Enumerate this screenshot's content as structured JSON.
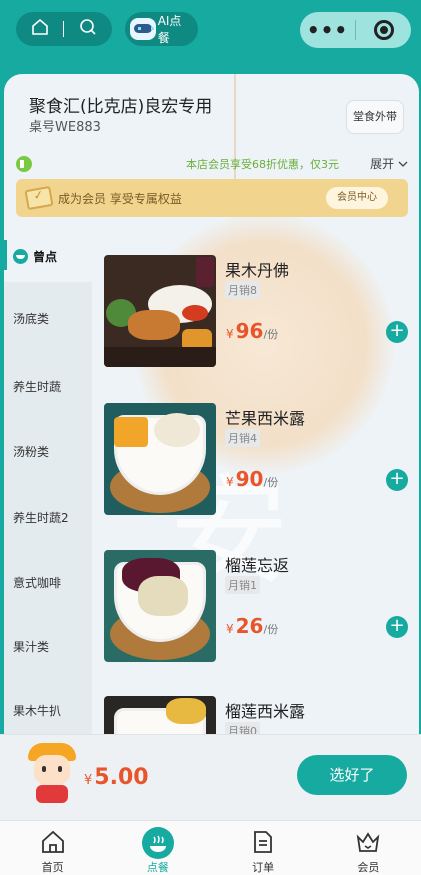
{
  "topbar": {
    "ai_label": "AI点餐",
    "capsule_more": "•••"
  },
  "store": {
    "name": "聚食汇(比克店)良宏专用",
    "table": "桌号WE883",
    "dine_toggle": "堂食外带"
  },
  "notice": {
    "text": "本店会员享受68折优惠，仅3元",
    "expand": "展开"
  },
  "member": {
    "text": "成为会员 享受专属权益",
    "button": "会员中心"
  },
  "categories": [
    {
      "label": "曾点"
    },
    {
      "label": "汤底类"
    },
    {
      "label": "养生时蔬"
    },
    {
      "label": "汤粉类"
    },
    {
      "label": "养生时蔬2"
    },
    {
      "label": "意式咖啡"
    },
    {
      "label": "果汁类"
    },
    {
      "label": "果木牛扒"
    }
  ],
  "dishes": [
    {
      "name": "果木丹佛",
      "sold": "月销8",
      "currency": "¥",
      "price": "96",
      "unit": "/份"
    },
    {
      "name": "芒果西米露",
      "sold": "月销4",
      "currency": "¥",
      "price": "90",
      "unit": "/份"
    },
    {
      "name": "榴莲忘返",
      "sold": "月销1",
      "currency": "¥",
      "price": "26",
      "unit": "/份"
    },
    {
      "name": "榴莲西米露",
      "sold": "月销0",
      "currency": "¥",
      "price": "",
      "unit": ""
    }
  ],
  "cart": {
    "currency": "¥",
    "total": "5.00",
    "checkout": "选好了"
  },
  "tabs": [
    {
      "label": "首页"
    },
    {
      "label": "点餐"
    },
    {
      "label": "订单"
    },
    {
      "label": "会员"
    }
  ],
  "colors": {
    "primary": "#16aaa0",
    "price": "#e8552a",
    "member_bar": "#f1d58f"
  }
}
